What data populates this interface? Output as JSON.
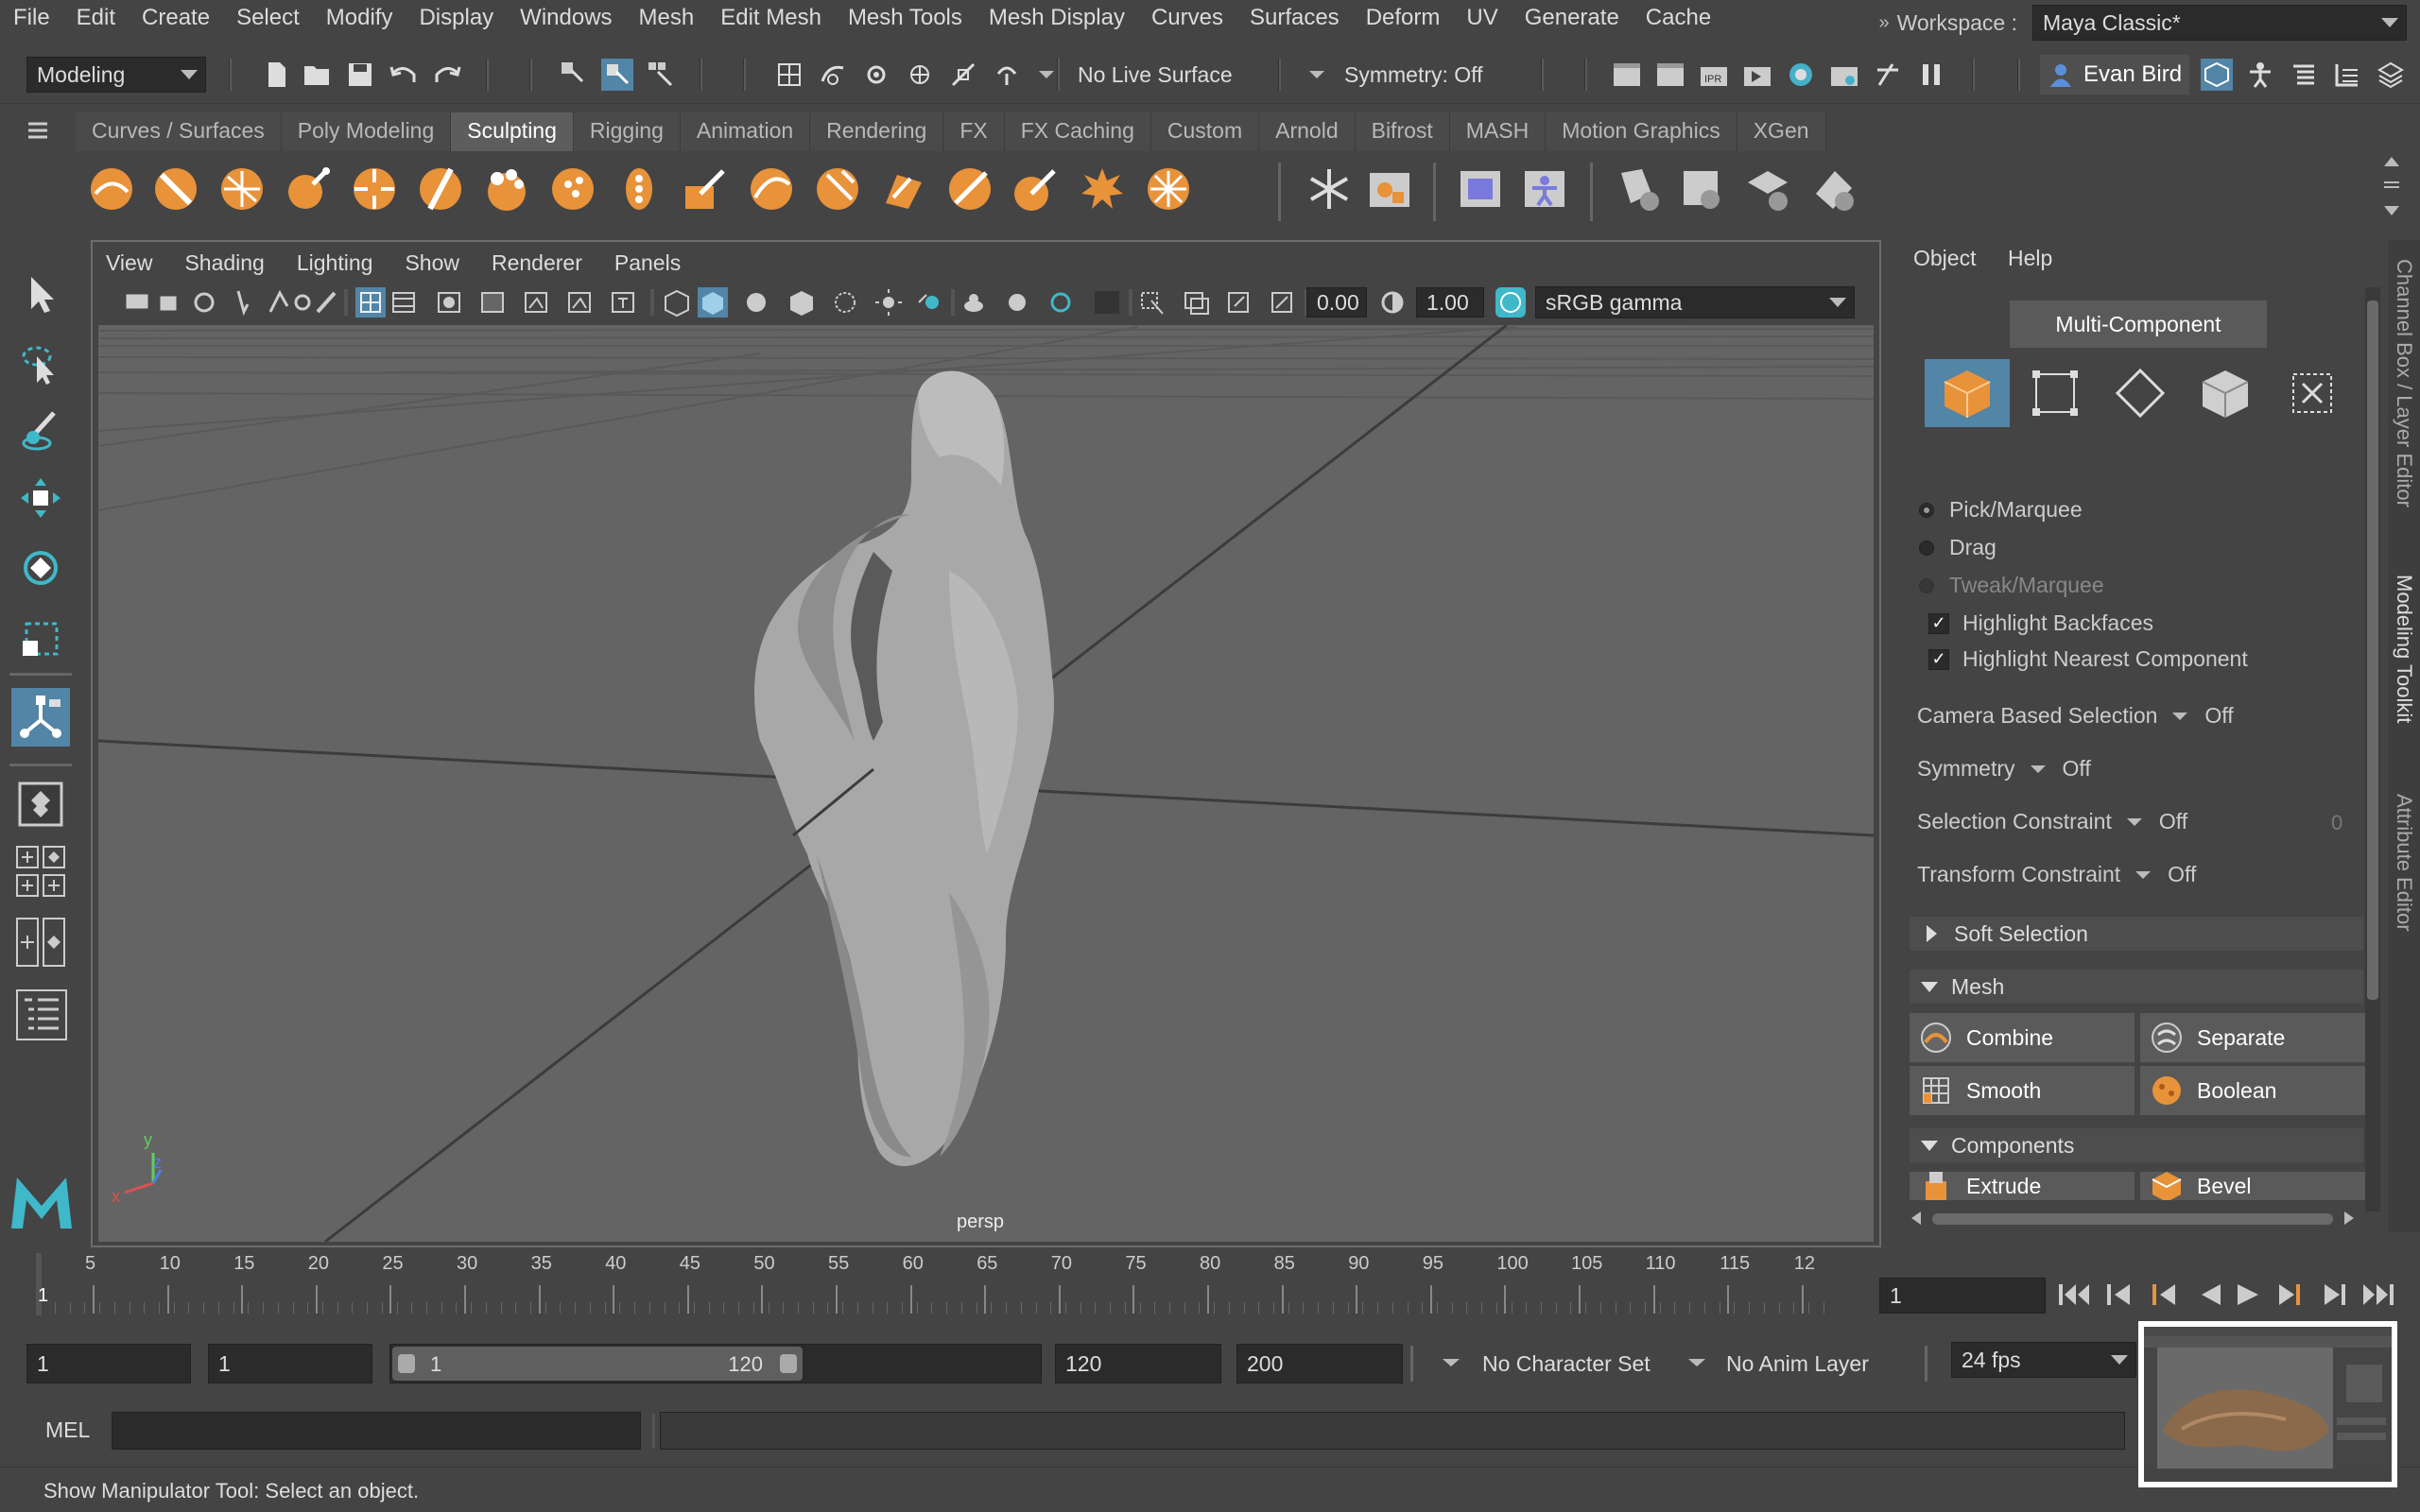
{
  "menubar": {
    "items": [
      "File",
      "Edit",
      "Create",
      "Select",
      "Modify",
      "Display",
      "Windows",
      "Mesh",
      "Edit Mesh",
      "Mesh Tools",
      "Mesh Display",
      "Curves",
      "Surfaces",
      "Deform",
      "UV",
      "Generate",
      "Cache"
    ],
    "workspace_label": "Workspace :",
    "workspace_value": "Maya Classic*"
  },
  "statusline": {
    "menuset": "Modeling",
    "live_surface": "No Live Surface",
    "symmetry": "Symmetry: Off",
    "user": "Evan Bird"
  },
  "shelf": {
    "tabs": [
      "Curves / Surfaces",
      "Poly Modeling",
      "Sculpting",
      "Rigging",
      "Animation",
      "Rendering",
      "FX",
      "FX Caching",
      "Custom",
      "Arnold",
      "Bifrost",
      "MASH",
      "Motion Graphics",
      "XGen"
    ],
    "active_tab": "Sculpting"
  },
  "viewport": {
    "menus": [
      "View",
      "Shading",
      "Lighting",
      "Show",
      "Renderer",
      "Panels"
    ],
    "exposure": "0.00",
    "gamma": "1.00",
    "color_space": "sRGB gamma",
    "camera_label": "persp",
    "axis_x": "x",
    "axis_y": "y",
    "axis_z": "z"
  },
  "toolkit": {
    "menus": [
      "Object",
      "Help"
    ],
    "mode_button": "Multi-Component",
    "pick_marquee": "Pick/Marquee",
    "drag": "Drag",
    "tweak_marquee": "Tweak/Marquee",
    "highlight_backfaces": "Highlight Backfaces",
    "highlight_nearest": "Highlight Nearest Component",
    "camera_based_selection": "Camera Based Selection",
    "camera_based_value": "Off",
    "symmetry": "Symmetry",
    "symmetry_value": "Off",
    "selection_constraint": "Selection Constraint",
    "selection_constraint_value": "Off",
    "selection_constraint_num": "0",
    "transform_constraint": "Transform Constraint",
    "transform_constraint_value": "Off",
    "soft_selection": "Soft Selection",
    "mesh_section": "Mesh",
    "combine": "Combine",
    "separate": "Separate",
    "smooth": "Smooth",
    "boolean": "Boolean",
    "components_section": "Components",
    "extrude": "Extrude",
    "bevel": "Bevel"
  },
  "side_tabs": [
    "Channel Box / Layer Editor",
    "Modeling Toolkit",
    "Attribute Editor"
  ],
  "timeslider": {
    "ticks": [
      "5",
      "10",
      "15",
      "20",
      "25",
      "30",
      "35",
      "40",
      "45",
      "50",
      "55",
      "60",
      "65",
      "70",
      "75",
      "80",
      "85",
      "90",
      "95",
      "100",
      "105",
      "110",
      "115",
      "12"
    ],
    "current_frame_marker": "1",
    "current_frame": "1"
  },
  "range": {
    "start": "1",
    "playback_start": "1",
    "slider_start": "1",
    "slider_end": "120",
    "playback_end": "120",
    "end": "200",
    "character_set": "No Character Set",
    "anim_layer": "No Anim Layer",
    "fps": "24 fps"
  },
  "cmdline": {
    "language": "MEL"
  },
  "helpline": {
    "text": "Show Manipulator Tool: Select an object."
  },
  "colors": {
    "accent_orange": "#e8923a",
    "active_blue": "#5285a6",
    "maya_logo": "#3fb8c9"
  }
}
